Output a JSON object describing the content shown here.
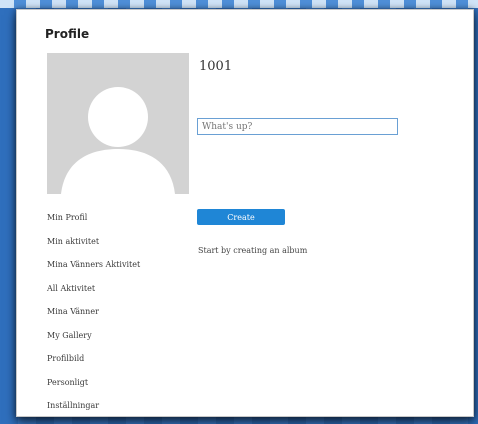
{
  "profile": {
    "title": "Profile",
    "username": "1001",
    "status_placeholder": "What's up?"
  },
  "album": {
    "create_label": "Create",
    "hint": "Start by creating an album"
  },
  "nav": {
    "items": [
      {
        "label": "Min Profil"
      },
      {
        "label": "Min aktivitet"
      },
      {
        "label": "Mina Vänners Aktivitet"
      },
      {
        "label": "All Aktivitet"
      },
      {
        "label": "Mina Vänner"
      },
      {
        "label": "My Gallery"
      },
      {
        "label": "Profilbild"
      },
      {
        "label": "Personligt"
      },
      {
        "label": "Inställningar"
      }
    ]
  },
  "colors": {
    "accent": "#1f86d6",
    "background": "#2f6fbd"
  },
  "icons": {
    "avatar": "default-user-silhouette"
  }
}
